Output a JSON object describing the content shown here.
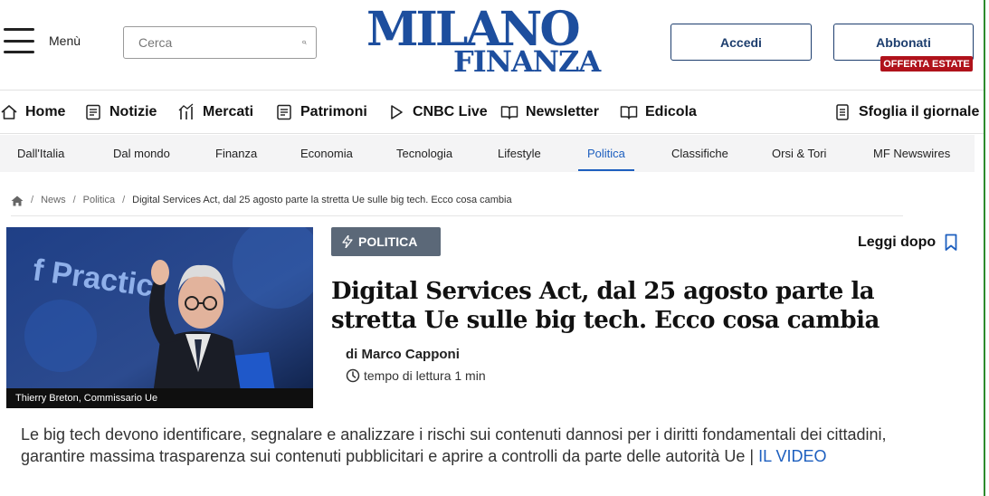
{
  "header": {
    "menu_label": "Menù",
    "search_placeholder": "Cerca",
    "logo_line1": "MILANO",
    "logo_line2": "FINANZA",
    "login_label": "Accedi",
    "subscribe_label": "Abbonati",
    "offer_badge": "OFFERTA ESTATE"
  },
  "mainnav": {
    "items": [
      {
        "label": "Home",
        "icon": "home-icon"
      },
      {
        "label": "Notizie",
        "icon": "news-icon"
      },
      {
        "label": "Mercati",
        "icon": "markets-icon"
      },
      {
        "label": "Patrimoni",
        "icon": "patrimoni-icon"
      },
      {
        "label": "CNBC Live",
        "icon": "play-icon"
      },
      {
        "label": "Newsletter",
        "icon": "book-icon"
      },
      {
        "label": "Edicola",
        "icon": "book-icon"
      }
    ],
    "sfoglia": {
      "label": "Sfoglia il giornale",
      "icon": "document-icon"
    }
  },
  "secnav": {
    "items": [
      "Dall'Italia",
      "Dal mondo",
      "Finanza",
      "Economia",
      "Tecnologia",
      "Lifestyle",
      "Politica",
      "Classifiche",
      "Orsi & Tori",
      "MF Newswires"
    ],
    "active": "Politica"
  },
  "breadcrumb": {
    "home_icon": "home-icon",
    "items": [
      "News",
      "Politica"
    ],
    "current": "Digital Services Act, dal 25 agosto parte la stretta Ue sulle big tech. Ecco cosa cambia"
  },
  "article": {
    "image_caption": "Thierry Breton, Commissario Ue",
    "image_overlay_text": "f Practic",
    "tag": "POLITICA",
    "read_later": "Leggi dopo",
    "title": "Digital Services Act, dal 25 agosto parte la stretta Ue sulle big tech. Ecco cosa cambia",
    "author_prefix": "di",
    "author": "Marco Capponi",
    "read_time": "tempo di lettura 1 min",
    "summary": "Le big tech devono identificare, segnalare e analizzare i rischi sui contenuti dannosi per i diritti fondamentali dei cittadini, garantire massima trasparenza sui contenuti pubblicitari e aprire a controlli da parte delle autorità Ue | ",
    "summary_link": "IL VIDEO"
  },
  "colors": {
    "brand_blue": "#1d4e9e",
    "accent_link": "#1d5fbf",
    "badge_red": "#b0121b",
    "tag_bg": "#5b6878"
  }
}
